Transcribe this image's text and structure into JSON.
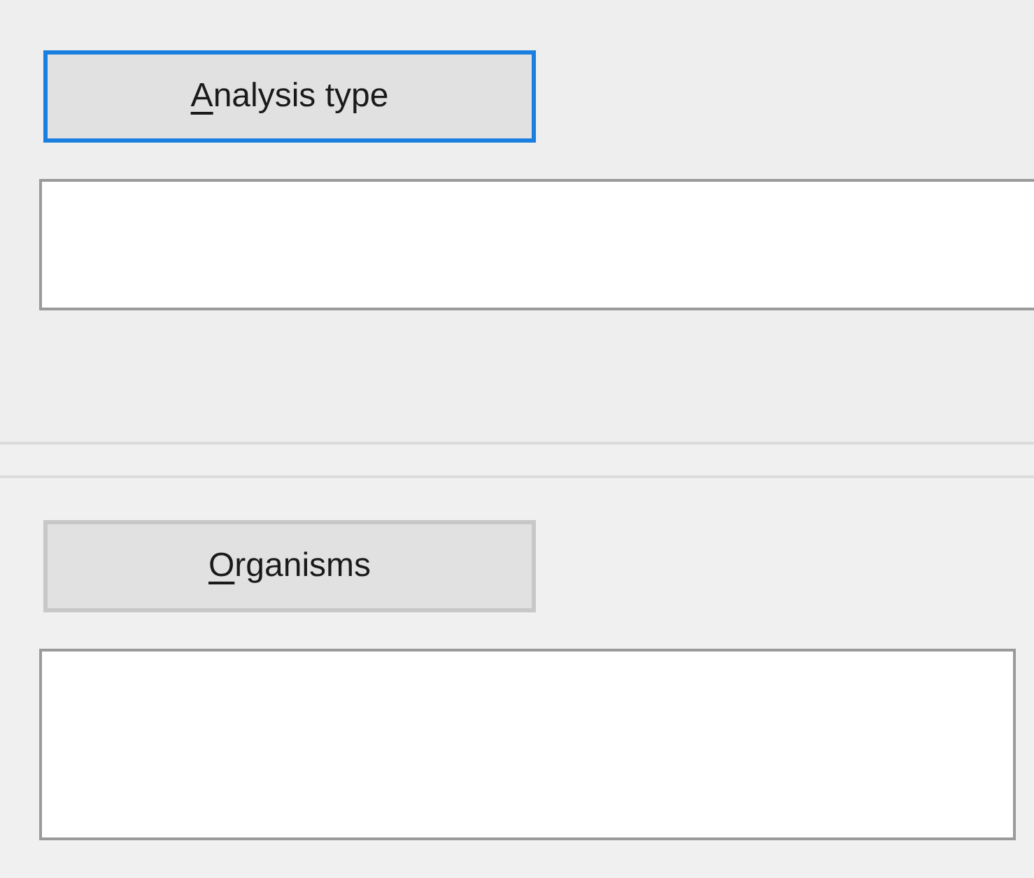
{
  "sections": [
    {
      "button": {
        "access_key": "A",
        "label_rest": "nalysis type",
        "focused": true
      }
    },
    {
      "button": {
        "access_key": "O",
        "label_rest": "rganisms",
        "focused": false
      }
    }
  ]
}
